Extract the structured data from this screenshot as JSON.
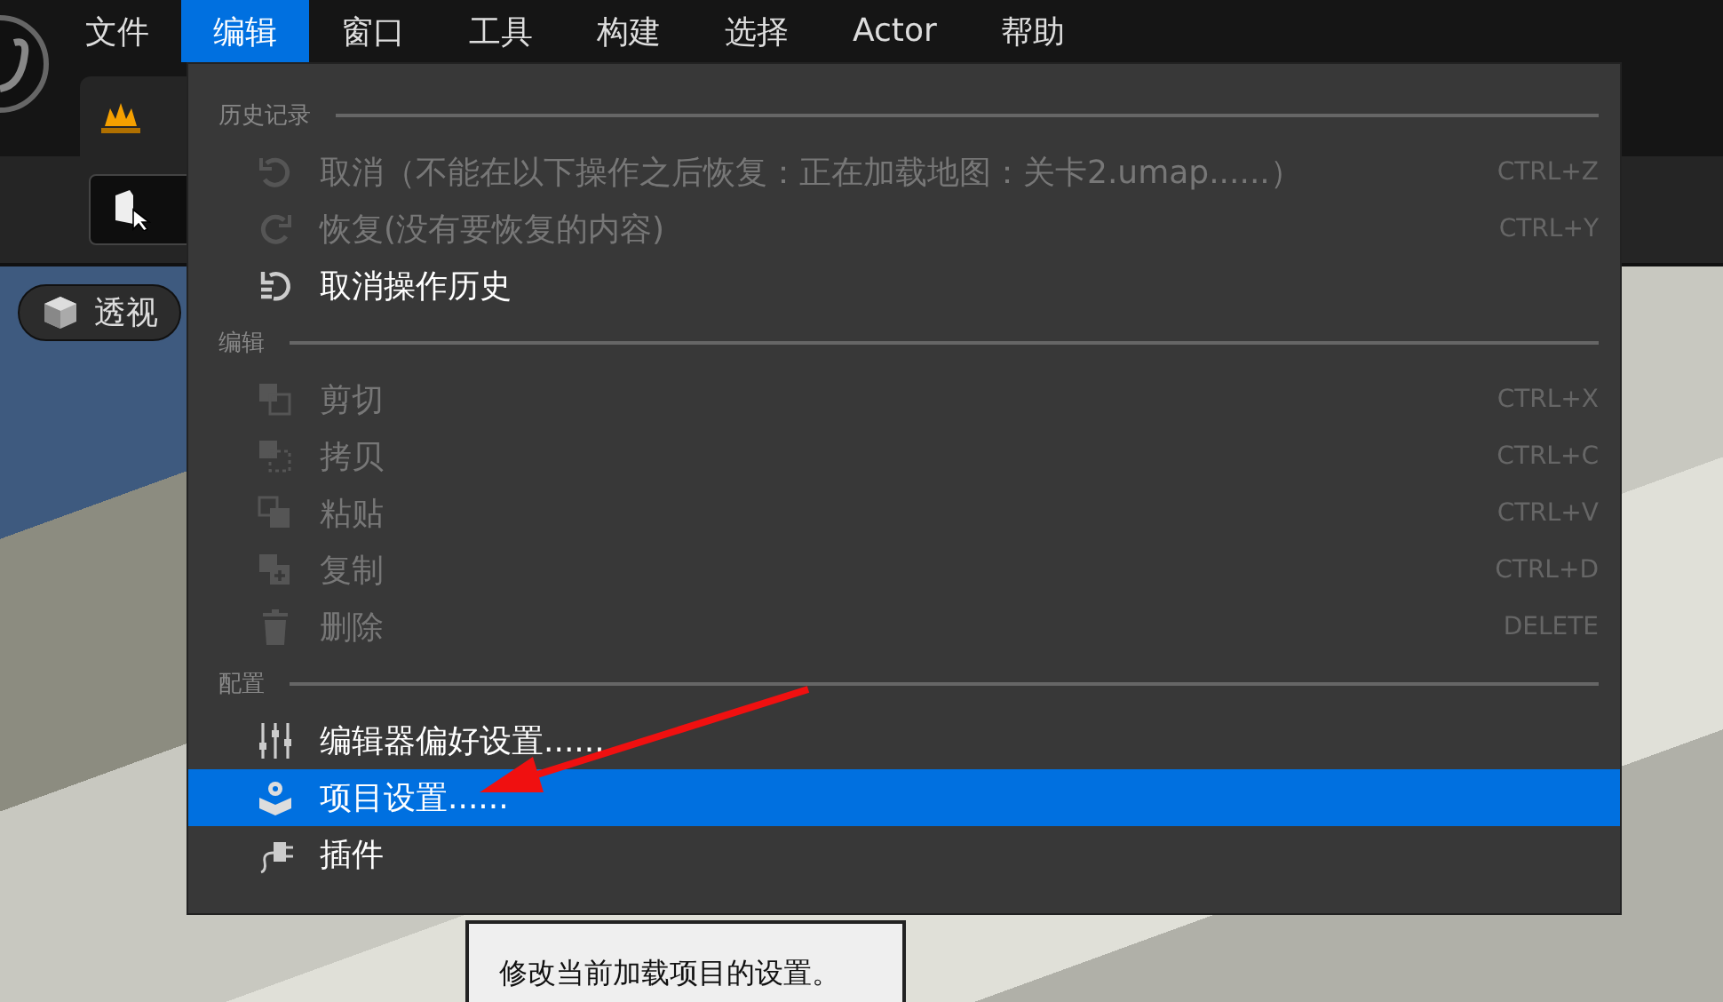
{
  "menubar": {
    "items": [
      {
        "label": "文件",
        "selected": false
      },
      {
        "label": "编辑",
        "selected": true
      },
      {
        "label": "窗口",
        "selected": false
      },
      {
        "label": "工具",
        "selected": false
      },
      {
        "label": "构建",
        "selected": false
      },
      {
        "label": "选择",
        "selected": false
      },
      {
        "label": "Actor",
        "selected": false
      },
      {
        "label": "帮助",
        "selected": false
      }
    ]
  },
  "viewport": {
    "view_mode": "透视"
  },
  "edit_menu": {
    "sections": [
      {
        "title": "历史记录",
        "items": [
          {
            "label": "取消（不能在以下操作之后恢复：正在加载地图：关卡2.umap......）",
            "shortcut": "CTRL+Z",
            "disabled": true,
            "selected": false
          },
          {
            "label": "恢复(没有要恢复的内容)",
            "shortcut": "CTRL+Y",
            "disabled": true,
            "selected": false
          },
          {
            "label": "取消操作历史",
            "disabled": false,
            "selected": false
          }
        ]
      },
      {
        "title": "编辑",
        "items": [
          {
            "label": "剪切",
            "shortcut": "CTRL+X",
            "disabled": true,
            "selected": false
          },
          {
            "label": "拷贝",
            "shortcut": "CTRL+C",
            "disabled": true,
            "selected": false
          },
          {
            "label": "粘贴",
            "shortcut": "CTRL+V",
            "disabled": true,
            "selected": false
          },
          {
            "label": "复制",
            "shortcut": "CTRL+D",
            "disabled": true,
            "selected": false
          },
          {
            "label": "删除",
            "shortcut": "DELETE",
            "disabled": true,
            "selected": false
          }
        ]
      },
      {
        "title": "配置",
        "items": [
          {
            "label": "编辑器偏好设置......",
            "disabled": false,
            "selected": false
          },
          {
            "label": "项目设置......",
            "disabled": false,
            "selected": true
          },
          {
            "label": "插件",
            "disabled": false,
            "selected": false
          }
        ]
      }
    ]
  },
  "tooltip": {
    "text": "修改当前加载项目的设置。"
  }
}
